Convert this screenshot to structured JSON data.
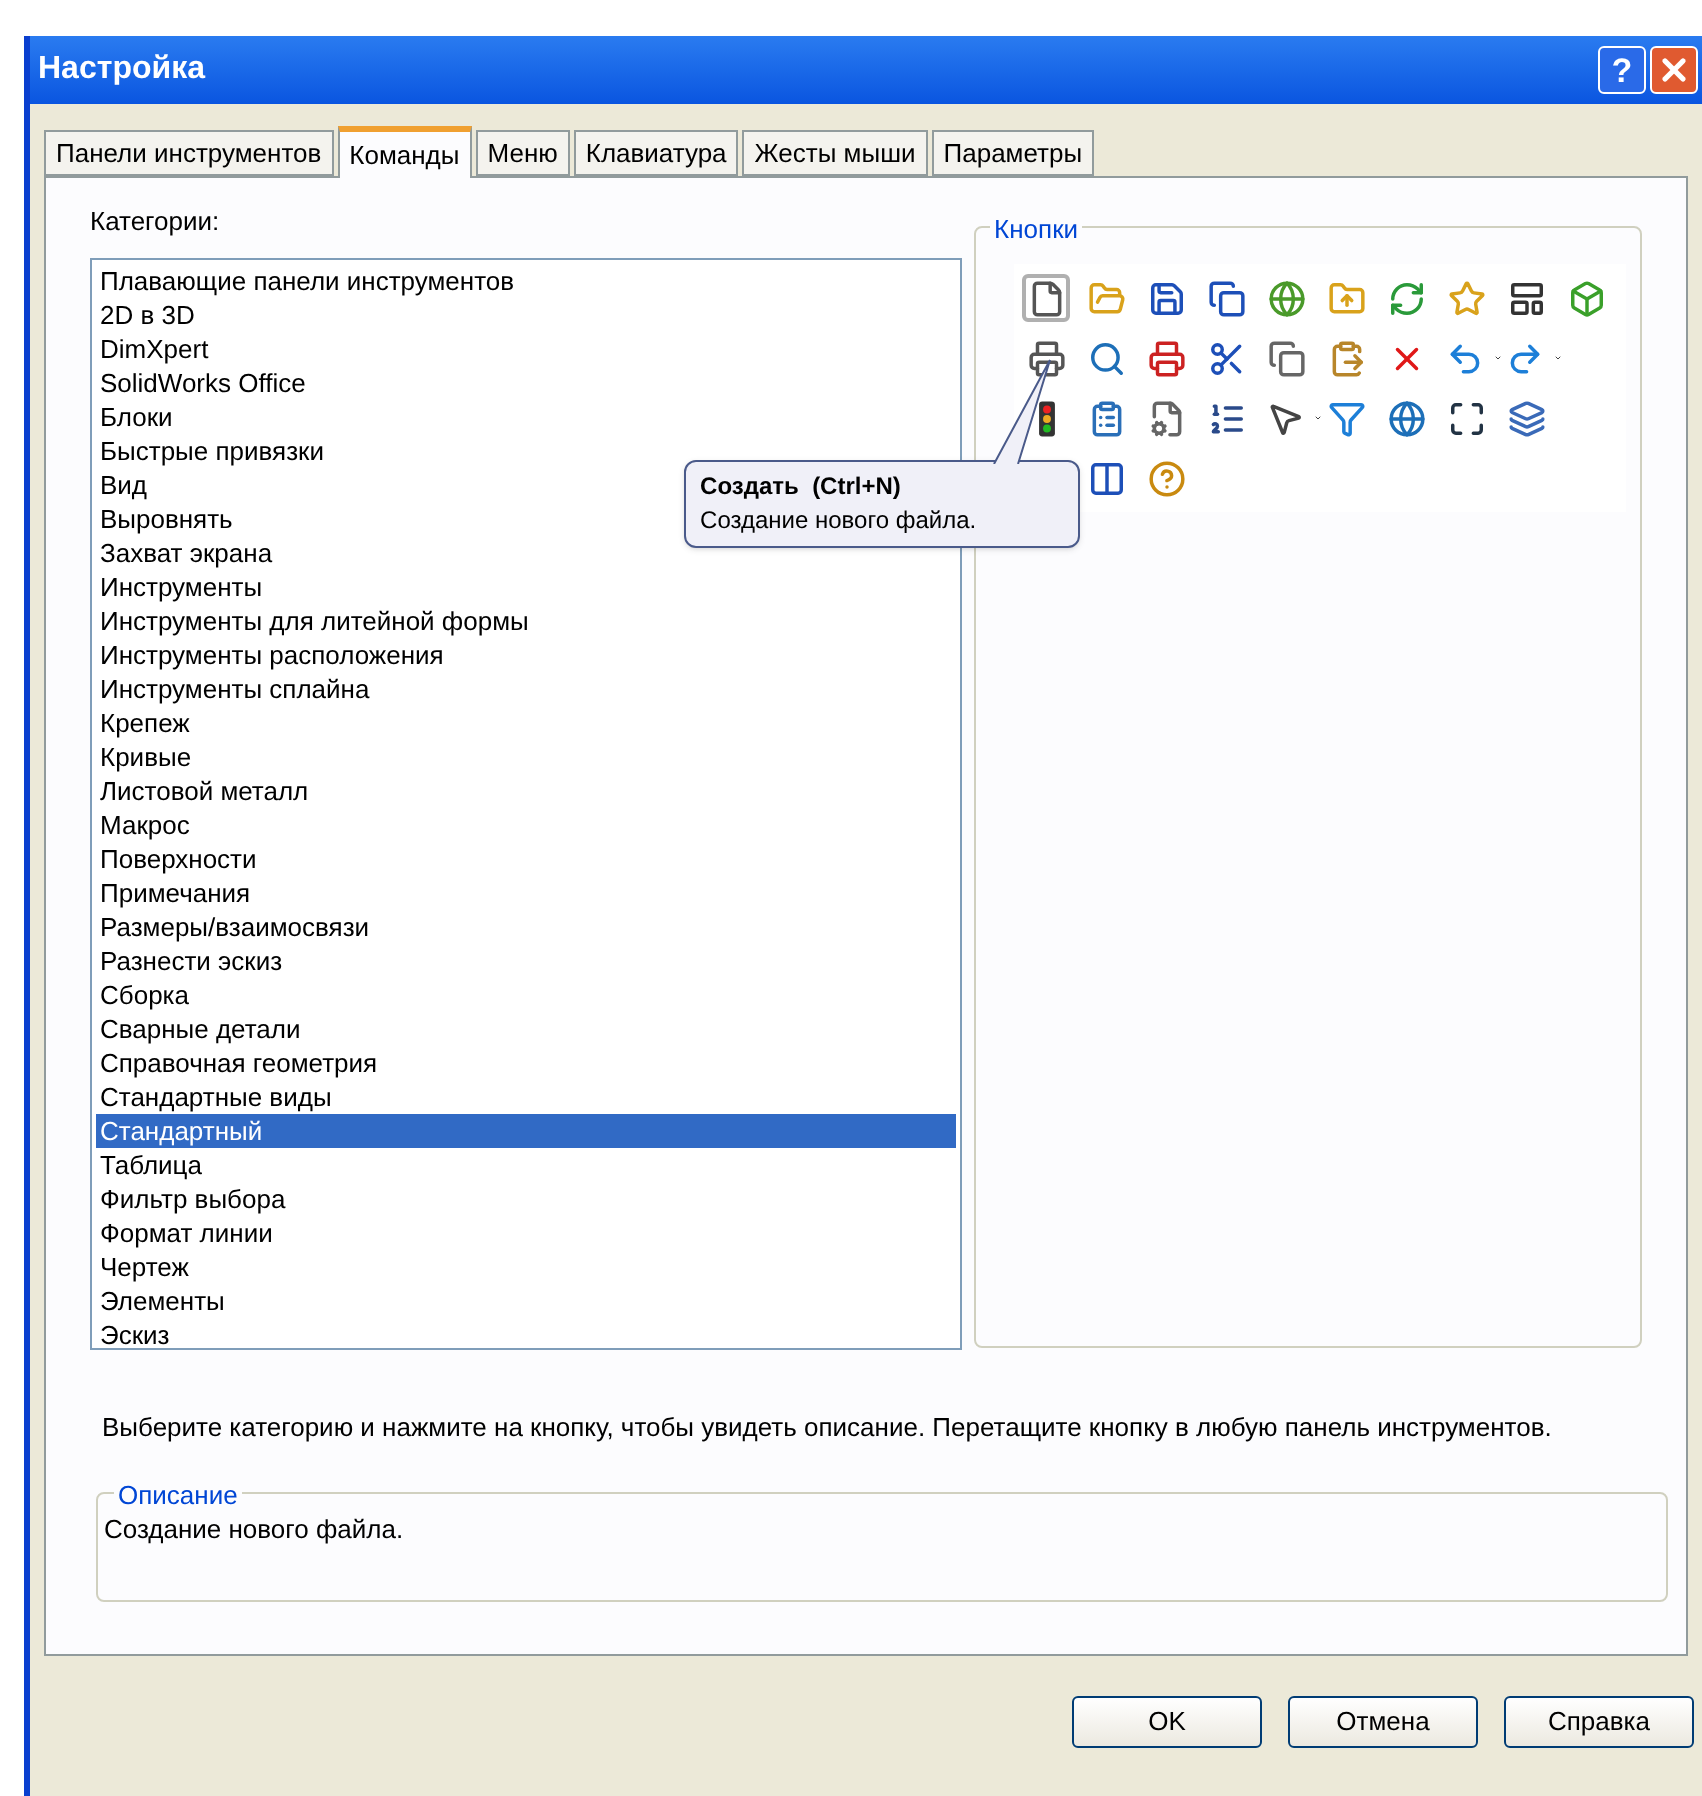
{
  "window": {
    "title": "Настройка",
    "help_button": "?"
  },
  "tabs": [
    {
      "label": "Панели инструментов",
      "selected": false
    },
    {
      "label": "Команды",
      "selected": true
    },
    {
      "label": "Меню",
      "selected": false
    },
    {
      "label": "Клавиатура",
      "selected": false
    },
    {
      "label": "Жесты мыши",
      "selected": false
    },
    {
      "label": "Параметры",
      "selected": false
    }
  ],
  "categories": {
    "label": "Категории:",
    "items": [
      {
        "label": "Плавающие панели инструментов",
        "selected": false
      },
      {
        "label": "2D в 3D",
        "selected": false
      },
      {
        "label": "DimXpert",
        "selected": false
      },
      {
        "label": "SolidWorks Office",
        "selected": false
      },
      {
        "label": "Блоки",
        "selected": false
      },
      {
        "label": "Быстрые привязки",
        "selected": false
      },
      {
        "label": "Вид",
        "selected": false
      },
      {
        "label": "Выровнять",
        "selected": false
      },
      {
        "label": "Захват экрана",
        "selected": false
      },
      {
        "label": "Инструменты",
        "selected": false
      },
      {
        "label": "Инструменты для литейной формы",
        "selected": false
      },
      {
        "label": "Инструменты расположения",
        "selected": false
      },
      {
        "label": "Инструменты сплайна",
        "selected": false
      },
      {
        "label": "Крепеж",
        "selected": false
      },
      {
        "label": "Кривые",
        "selected": false
      },
      {
        "label": "Листовой металл",
        "selected": false
      },
      {
        "label": "Макрос",
        "selected": false
      },
      {
        "label": "Поверхности",
        "selected": false
      },
      {
        "label": "Примечания",
        "selected": false
      },
      {
        "label": "Размеры/взаимосвязи",
        "selected": false
      },
      {
        "label": "Разнести эскиз",
        "selected": false
      },
      {
        "label": "Сборка",
        "selected": false
      },
      {
        "label": "Сварные детали",
        "selected": false
      },
      {
        "label": "Справочная геометрия",
        "selected": false
      },
      {
        "label": "Стандартные виды",
        "selected": false
      },
      {
        "label": "Стандартный",
        "selected": true
      },
      {
        "label": "Таблица",
        "selected": false
      },
      {
        "label": "Фильтр выбора",
        "selected": false
      },
      {
        "label": "Формат линии",
        "selected": false
      },
      {
        "label": "Чертеж",
        "selected": false
      },
      {
        "label": "Элементы",
        "selected": false
      },
      {
        "label": "Эскиз",
        "selected": false
      }
    ]
  },
  "buttons_group": {
    "label": "Кнопки",
    "rows": [
      [
        {
          "kind": "new",
          "selected": true
        },
        {
          "kind": "open",
          "selected": false
        },
        {
          "kind": "save",
          "selected": false
        },
        {
          "kind": "save_all",
          "selected": false
        },
        {
          "kind": "web",
          "selected": false
        },
        {
          "kind": "folder_up",
          "selected": false
        },
        {
          "kind": "rebuild",
          "selected": false
        },
        {
          "kind": "star",
          "selected": false
        },
        {
          "kind": "template",
          "selected": false
        },
        {
          "kind": "box",
          "selected": false
        }
      ],
      [
        {
          "kind": "print",
          "selected": false
        },
        {
          "kind": "preview",
          "selected": false
        },
        {
          "kind": "print3d",
          "selected": false
        },
        {
          "kind": "cut",
          "selected": false
        },
        {
          "kind": "copy",
          "selected": false
        },
        {
          "kind": "paste",
          "selected": false
        },
        {
          "kind": "delete",
          "selected": false
        },
        {
          "kind": "undo",
          "selected": false,
          "dropdown": true
        },
        {
          "kind": "redo",
          "selected": false,
          "dropdown": true
        }
      ],
      [
        {
          "kind": "traffic",
          "selected": false
        },
        {
          "kind": "checklist",
          "selected": false
        },
        {
          "kind": "properties",
          "selected": false
        },
        {
          "kind": "list",
          "selected": false
        },
        {
          "kind": "pointer",
          "selected": false,
          "dropdown": true
        },
        {
          "kind": "filter",
          "selected": false
        },
        {
          "kind": "globe",
          "selected": false
        },
        {
          "kind": "fit",
          "selected": false
        },
        {
          "kind": "layers",
          "selected": false
        }
      ],
      [
        {
          "kind": "columns",
          "selected": false
        },
        {
          "kind": "help",
          "selected": false
        }
      ]
    ]
  },
  "tooltip": {
    "title": "Создать  (Ctrl+N)",
    "text": "Создание нового файла."
  },
  "hint": "Выберите категорию и нажмите на кнопку, чтобы увидеть описание. Перетащите кнопку в любую панель инструментов.",
  "description": {
    "label": "Описание",
    "text": "Создание нового файла."
  },
  "footer_buttons": [
    "OK",
    "Отмена",
    "Справка"
  ]
}
